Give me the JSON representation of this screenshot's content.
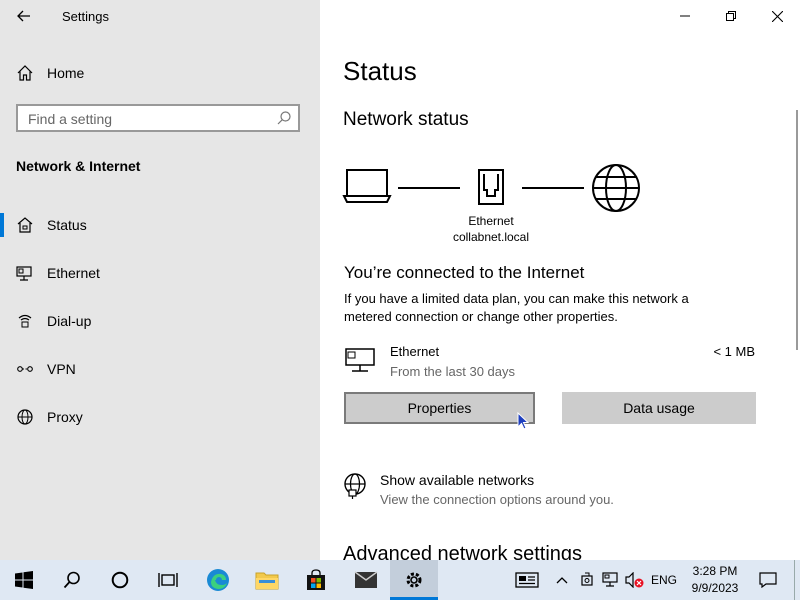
{
  "window": {
    "title": "Settings"
  },
  "sidebar": {
    "home_label": "Home",
    "search_placeholder": "Find a setting",
    "section_title": "Network & Internet",
    "items": [
      {
        "label": "Status",
        "icon": "home-network-icon",
        "active": true
      },
      {
        "label": "Ethernet",
        "icon": "ethernet-icon"
      },
      {
        "label": "Dial-up",
        "icon": "dialup-icon"
      },
      {
        "label": "VPN",
        "icon": "vpn-icon"
      },
      {
        "label": "Proxy",
        "icon": "globe-icon"
      }
    ]
  },
  "main": {
    "page_title": "Status",
    "network_status_heading": "Network status",
    "adapter_name": "Ethernet",
    "domain": "collabnet.local",
    "connected_heading": "You’re connected to the Internet",
    "connected_desc": "If you have a limited data plan, you can make this network a metered connection or change other properties.",
    "usage": {
      "name": "Ethernet",
      "period": "From the last 30 days",
      "amount": "< 1 MB"
    },
    "properties_button": "Properties",
    "data_usage_button": "Data usage",
    "show_networks": {
      "title": "Show available networks",
      "desc": "View the connection options around you."
    },
    "advanced_heading": "Advanced network settings"
  },
  "taskbar": {
    "time": "3:28 PM",
    "date": "9/9/2023",
    "language": "ENG",
    "accent_color": "#0078d7"
  }
}
